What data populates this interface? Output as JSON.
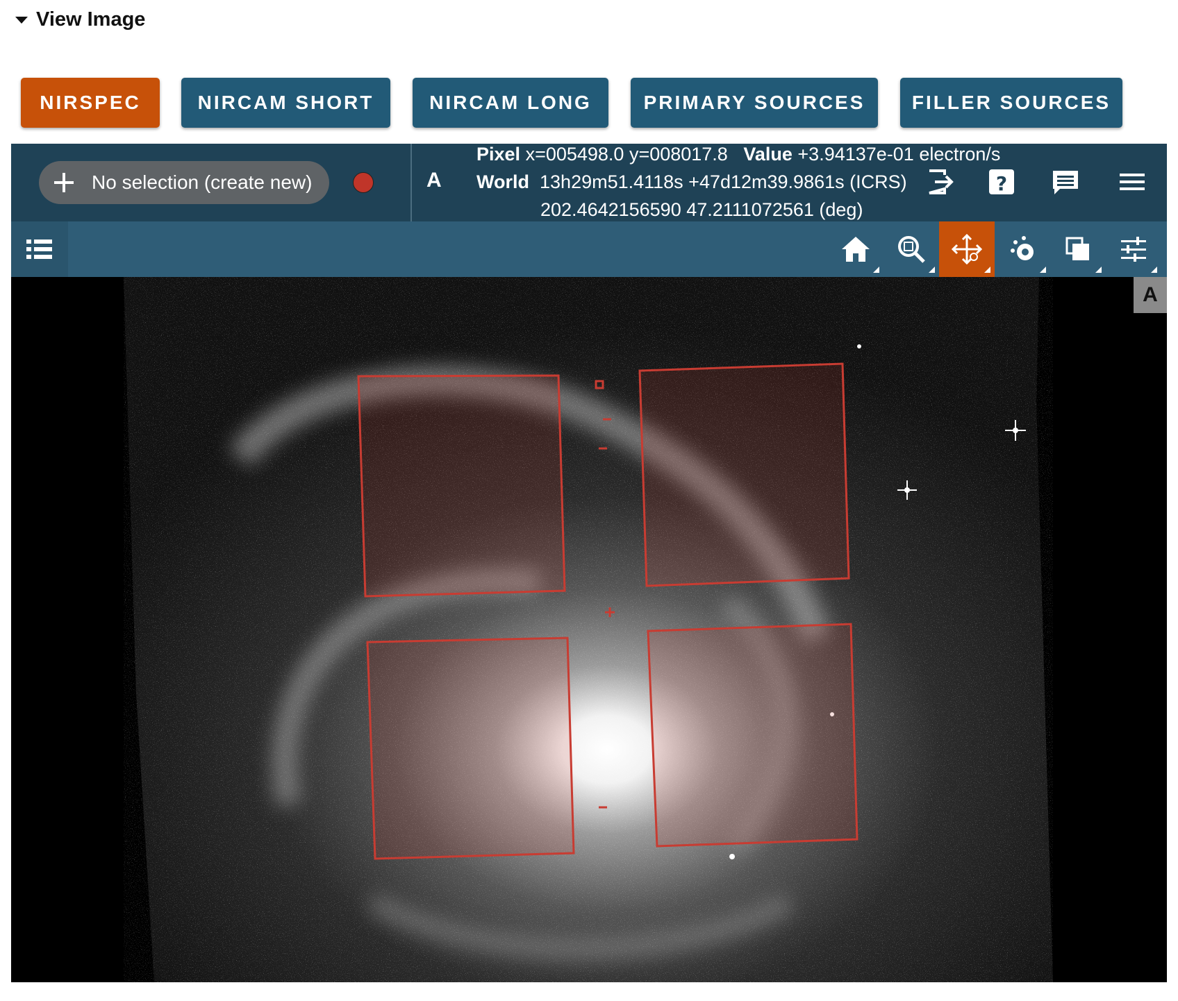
{
  "section": {
    "title": "View Image"
  },
  "instrument_buttons": [
    {
      "label": "NIRSPEC",
      "active": true
    },
    {
      "label": "NIRCAM SHORT",
      "active": false
    },
    {
      "label": "NIRCAM LONG",
      "active": false
    },
    {
      "label": "PRIMARY SOURCES",
      "active": false
    },
    {
      "label": "FILLER SOURCES",
      "active": false
    }
  ],
  "topbar": {
    "selection_label": "No selection (create new)",
    "selection_color": "#c03529",
    "viewer_letter": "A",
    "pixel_label": "Pixel",
    "pixel_value": "x=005498.0 y=008017.8",
    "value_label": "Value",
    "value_value": "+3.94137e-01 electron/s",
    "world_label": "World",
    "world_value": "13h29m51.4118s +47d12m39.9861s (ICRS)",
    "world_deg": "202.4642156590 47.2111072561 (deg)"
  },
  "topbar_icons": [
    "export-icon",
    "help-icon",
    "comment-icon",
    "menu-icon"
  ],
  "toolbar": {
    "tools": [
      "home-icon",
      "zoom-icon",
      "pan-zoom-icon",
      "contrast-icon",
      "layers-icon",
      "settings-icon"
    ],
    "active_tool": "pan-zoom-icon"
  },
  "viewer": {
    "corner_label": "A"
  },
  "colors": {
    "accent": "#c75109",
    "button": "#225a77",
    "topbar": "#1f4256",
    "toolbar": "#2f5d77",
    "footprint": "#c83c32"
  }
}
